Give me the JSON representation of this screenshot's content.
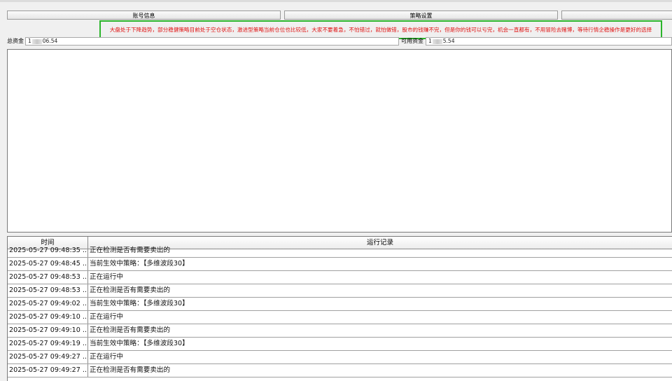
{
  "tabs": [
    {
      "label": "账号信息"
    },
    {
      "label": "策略设置"
    },
    {
      "label": ""
    }
  ],
  "notice": {
    "text": "大盘处于下降趋势，部分稳健策略目前处于空仓状态，激进型策略当前仓位也比较低，大家不要着急，不怕错过，就怕做错，股市的钱赚不完，但是你的钱可以亏完，机会一直都有，不用冒险去赌博，等待行情企稳操作是更好的选择",
    "color": "#e01010",
    "border_color": "#2bb52b"
  },
  "account": {
    "total_label": "总资金",
    "total_prefix": "1",
    "total_suffix": "06.54",
    "available_label": "可用资金",
    "available_prefix": "1",
    "available_suffix": "5.54"
  },
  "log": {
    "headers": {
      "time": "时间",
      "record": "运行记录"
    },
    "rows": [
      {
        "time": "2025-05-27 09:48:35 ...",
        "record": "正在检测是否有需要卖出的"
      },
      {
        "time": "2025-05-27 09:48:45 ...",
        "record": "当前生效中策略：【多维波段30】"
      },
      {
        "time": "2025-05-27 09:48:53 ...",
        "record": "正在运行中"
      },
      {
        "time": "2025-05-27 09:48:53 ...",
        "record": "正在检测是否有需要卖出的"
      },
      {
        "time": "2025-05-27 09:49:02 ...",
        "record": "当前生效中策略：【多维波段30】"
      },
      {
        "time": "2025-05-27 09:49:10 ...",
        "record": "正在运行中"
      },
      {
        "time": "2025-05-27 09:49:10 ...",
        "record": "正在检测是否有需要卖出的"
      },
      {
        "time": "2025-05-27 09:49:19 ...",
        "record": "当前生效中策略：【多维波段30】"
      },
      {
        "time": "2025-05-27 09:49:27 ...",
        "record": "正在运行中"
      },
      {
        "time": "2025-05-27 09:49:27 ...",
        "record": "正在检测是否有需要卖出的"
      }
    ]
  }
}
